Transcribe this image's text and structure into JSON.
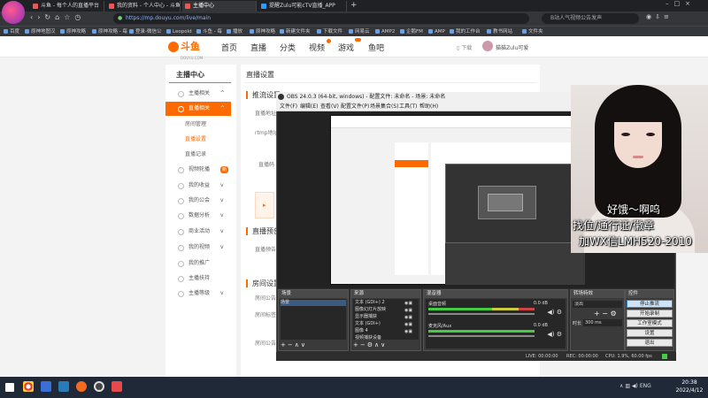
{
  "browser": {
    "tabs": [
      {
        "label": "斗鱼 - 每个人的直播平台"
      },
      {
        "label": "我的资料 - 个人中心 - 斗鱼"
      },
      {
        "label": "主播中心"
      },
      {
        "label": "提醒Zulu可能cTV直播_APP"
      }
    ],
    "url": "https://mp.douyu.com/live/main",
    "search_placeholder": "B站人气视频公告发声",
    "bookmarks": [
      "百度",
      "原神地图汉",
      "原神攻略",
      "原神攻略 - 每",
      "登录-微信公",
      "Leopold",
      "斗鱼 - 每",
      "播放",
      "原神攻略",
      "新建文件夹",
      "下载文件",
      "网易云",
      "AMP2",
      "企鹅FM",
      "AMP",
      "我的工作台",
      "教书网站",
      "文件夹"
    ],
    "user_label": "猫猫Zulu可爱"
  },
  "site": {
    "logo": "斗鱼",
    "logo_sub": "DOUYU.COM",
    "nav": [
      "首页",
      "直播",
      "分类",
      "视频",
      "游戏",
      "鱼吧"
    ],
    "download": "下载"
  },
  "sidebar": {
    "title": "主播中心",
    "items": [
      {
        "label": "主播相关"
      },
      {
        "label": "直播相关"
      },
      {
        "label": "房间管理"
      },
      {
        "label": "直播设置"
      },
      {
        "label": "直播记录"
      },
      {
        "label": "视频轮播"
      },
      {
        "label": "我的收益"
      },
      {
        "label": "我的公会"
      },
      {
        "label": "数据分析"
      },
      {
        "label": "商业活动"
      },
      {
        "label": "我的视频"
      },
      {
        "label": "我的推广"
      },
      {
        "label": "主播扶持"
      },
      {
        "label": "主播等级"
      }
    ],
    "badge": "新"
  },
  "content": {
    "title": "直播设置",
    "section1": "推流设置",
    "label_server": "直播地址",
    "label_rtmp": "rtmp地址",
    "label_code": "直播码",
    "section2": "直播预告",
    "label_notice": "直播预告",
    "section3": "房间设置",
    "label_room": "房间公告",
    "label_card": "房间标签",
    "label_share": "房间公告"
  },
  "obs": {
    "title": "OBS 24.0.3 (64-bit, windows) - 配置文件: 未命名 - 场景: 未命名",
    "menu": [
      "文件(F)",
      "编辑(E)",
      "查看(V)",
      "配置文件(P)",
      "场景集合(S)",
      "工具(T)",
      "帮助(H)"
    ],
    "docks": {
      "scenes": "场景",
      "sources": "来源",
      "mixer": "混音器",
      "transitions": "转场特效",
      "controls": "控件"
    },
    "scene_items": [
      "场景"
    ],
    "source_items": [
      "文本 (GDI+) 2",
      "图像幻灯片放映",
      "显示器捕获",
      "文本 (GDI+)",
      "图像 4",
      "视频捕获设备"
    ],
    "mixer_items": [
      {
        "name": "桌面音频",
        "db": "0.0 dB"
      },
      {
        "name": "麦克风/Aux",
        "db": "0.0 dB"
      }
    ],
    "transition": "淡出",
    "duration_label": "时长",
    "duration": "300 ms",
    "controls": [
      "停止推流",
      "开始录制",
      "工作室模式",
      "设置",
      "退出"
    ],
    "status": {
      "live": "LIVE: 00:00:00",
      "rec": "REC: 00:00:00",
      "cpu": "CPU: 1.9%, 60.00 fps"
    }
  },
  "webcam": {
    "line1": "好饿～啊呜",
    "line2": "找位/通行证/徽章",
    "line3": "加WX信LMH520-2010"
  },
  "taskbar": {
    "lang": "ENG",
    "time": "20:38",
    "date": "2022/4/12"
  }
}
